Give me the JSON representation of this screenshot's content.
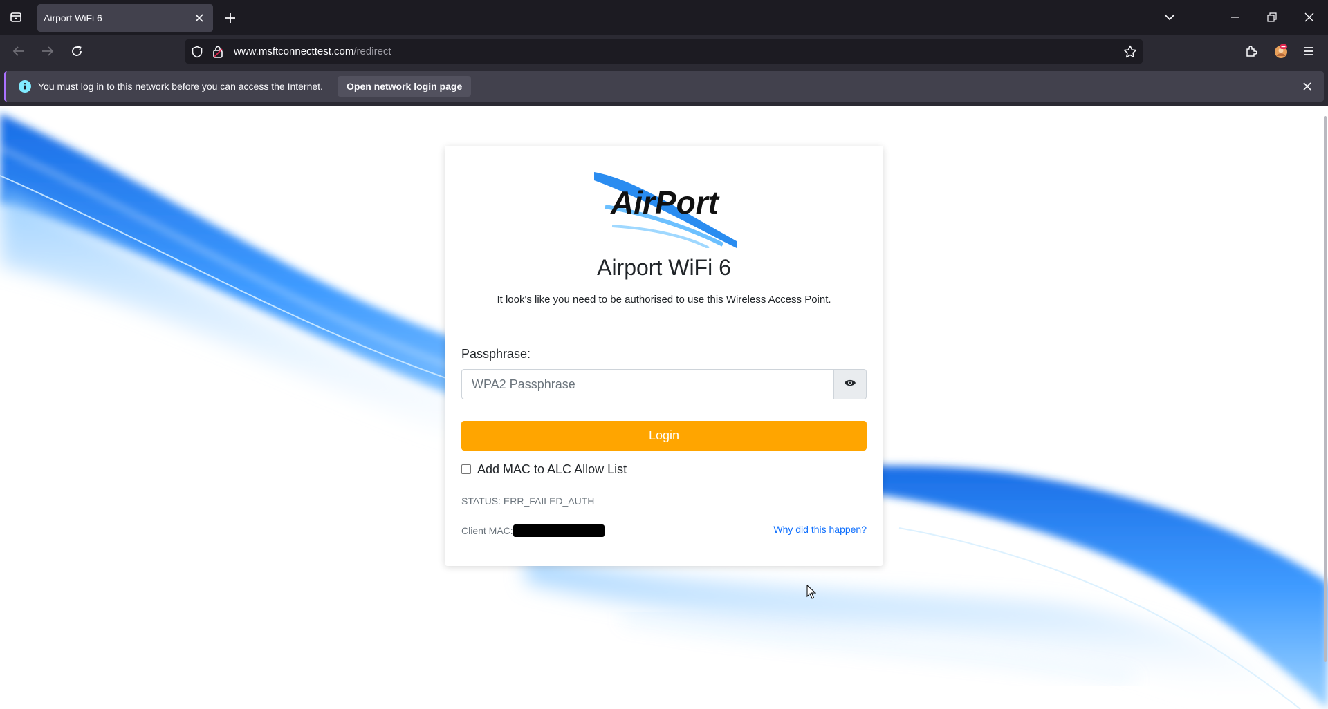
{
  "browser": {
    "tab": {
      "title": "Airport WiFi 6"
    },
    "url": {
      "host": "www.msftconnecttest.com",
      "path": "/redirect"
    },
    "notification": {
      "message": "You must log in to this network before you can access the Internet.",
      "button_label": "Open network login page"
    },
    "accent_color": "#ab71ff"
  },
  "page": {
    "logo": {
      "text": "AirPort"
    },
    "title": "Airport WiFi 6",
    "subtitle": "It look's like you need to be authorised to use this Wireless Access Point.",
    "passphrase": {
      "label": "Passphrase:",
      "placeholder": "WPA2 Passphrase",
      "value": ""
    },
    "login_label": "Login",
    "login_color": "#ffa500",
    "mac_checkbox": {
      "label": "Add MAC to ALC Allow List",
      "checked": false
    },
    "status": "STATUS: ERR_FAILED_AUTH",
    "client_mac_label": "Client MAC:",
    "why_link": "Why did this happen?",
    "link_color": "#0d6efd"
  }
}
